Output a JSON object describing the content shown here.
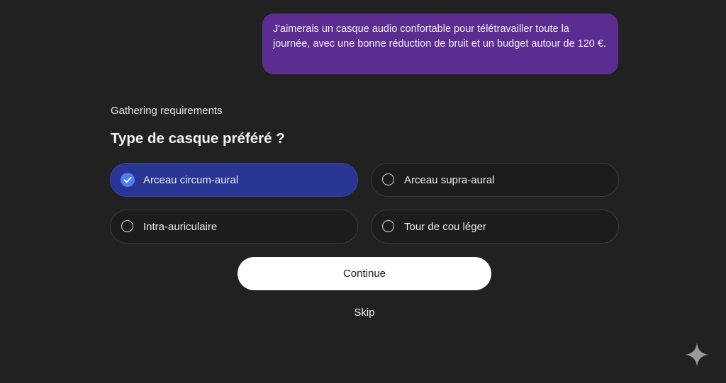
{
  "user_message": {
    "text": "J'aimerais un casque audio confortable pour télétravailler toute la journée, avec une bonne réduction de bruit et un budget autour de 120 €."
  },
  "status": {
    "label": "Gathering requirements"
  },
  "question": {
    "title": "Type de casque préféré ?",
    "options": [
      {
        "label": "Arceau circum-aural",
        "selected": true
      },
      {
        "label": "Arceau supra-aural",
        "selected": false
      },
      {
        "label": "Intra-auriculaire",
        "selected": false
      },
      {
        "label": "Tour de cou léger",
        "selected": false
      }
    ]
  },
  "actions": {
    "continue_label": "Continue",
    "skip_label": "Skip"
  },
  "icons": {
    "selected_check": "check-circle-icon",
    "unselected": "radio-empty-icon",
    "corner": "sparkle-icon"
  },
  "colors": {
    "background": "#212121",
    "user_bubble": "#5b2d91",
    "option_selected": "#283593",
    "check_accent": "#4d7cff",
    "continue_button": "#ffffff"
  }
}
